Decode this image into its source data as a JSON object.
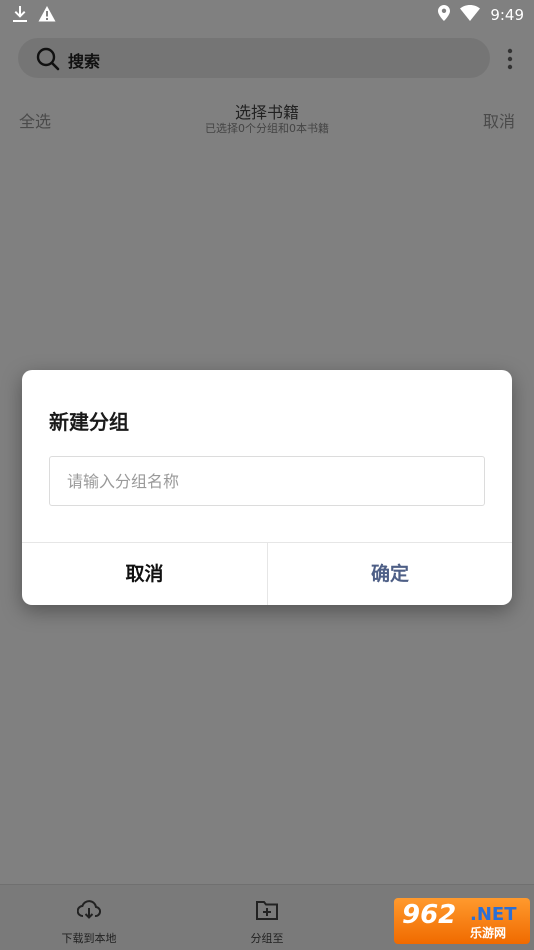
{
  "status_bar": {
    "time": "9:49",
    "left_icons": [
      "download-icon",
      "warning-icon"
    ],
    "right_icons": [
      "location-icon",
      "wifi-icon"
    ]
  },
  "search": {
    "label": "搜索",
    "icon": "search-icon",
    "more_icon": "more-vertical-icon"
  },
  "selection_bar": {
    "select_all": "全选",
    "title": "选择书籍",
    "subtitle": "已选择0个分组和0本书籍",
    "cancel": "取消"
  },
  "dialog": {
    "title": "新建分组",
    "input_placeholder": "请输入分组名称",
    "input_value": "",
    "cancel_label": "取消",
    "confirm_label": "确定",
    "confirm_color": "#4e5f86"
  },
  "bottom_bar": {
    "items": [
      {
        "label": "下载到本地",
        "icon": "cloud-download-icon"
      },
      {
        "label": "分组至",
        "icon": "folder-add-icon"
      }
    ]
  },
  "watermark": {
    "number": "962",
    "suffix": ".NET",
    "text": "乐游网"
  }
}
